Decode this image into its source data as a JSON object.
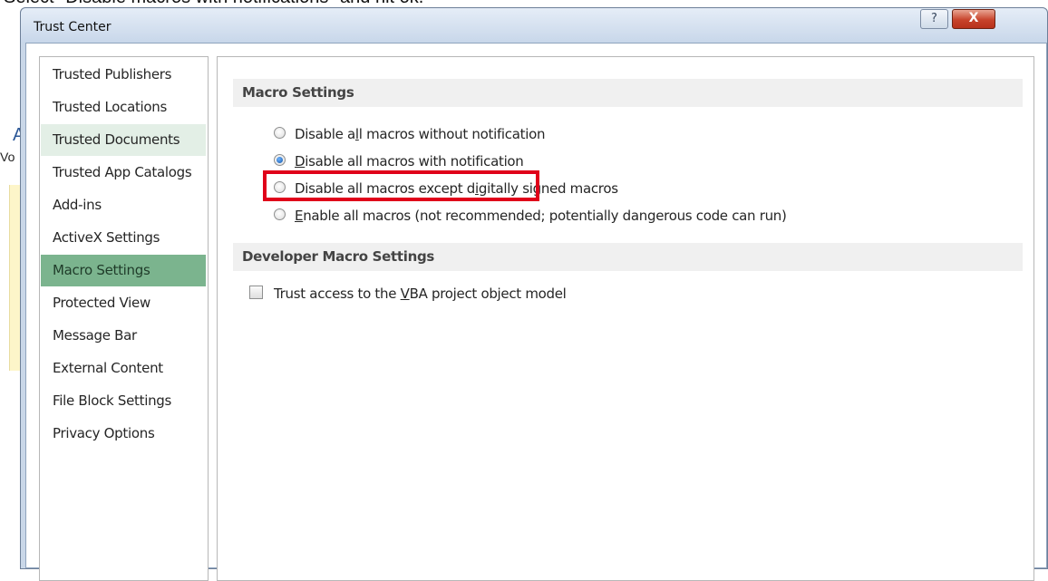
{
  "background": {
    "caption": "Select \"Disable macros with notifications\" and hit ok.",
    "letter_a": "A",
    "letter_vo": "Vo"
  },
  "dialog": {
    "title": "Trust Center",
    "help_glyph": "?",
    "close_glyph": "X"
  },
  "sidebar": {
    "items": [
      {
        "label": "Trusted Publishers",
        "state": "normal"
      },
      {
        "label": "Trusted Locations",
        "state": "normal"
      },
      {
        "label": "Trusted Documents",
        "state": "hover"
      },
      {
        "label": "Trusted App Catalogs",
        "state": "normal"
      },
      {
        "label": "Add-ins",
        "state": "normal"
      },
      {
        "label": "ActiveX Settings",
        "state": "normal"
      },
      {
        "label": "Macro Settings",
        "state": "selected"
      },
      {
        "label": "Protected View",
        "state": "normal"
      },
      {
        "label": "Message Bar",
        "state": "normal"
      },
      {
        "label": "External Content",
        "state": "normal"
      },
      {
        "label": "File Block Settings",
        "state": "normal"
      },
      {
        "label": "Privacy Options",
        "state": "normal"
      }
    ]
  },
  "macro_settings": {
    "header": "Macro Settings",
    "options": [
      {
        "pre": "Disable a",
        "acc": "l",
        "post": "l macros without notification",
        "checked": false
      },
      {
        "pre": "",
        "acc": "D",
        "post": "isable all macros with notification",
        "checked": true
      },
      {
        "pre": "Disable all macros except d",
        "acc": "i",
        "post": "gitally signed macros",
        "checked": false
      },
      {
        "pre": "",
        "acc": "E",
        "post": "nable all macros (not recommended; potentially dangerous code can run)",
        "checked": false
      }
    ]
  },
  "developer_settings": {
    "header": "Developer Macro Settings",
    "checkbox": {
      "pre": "Trust access to the ",
      "acc": "V",
      "post": "BA project object model",
      "checked": false
    }
  },
  "colors": {
    "selected_nav": "#7bb48e",
    "hover_nav": "#e3efe6",
    "highlight": "#e0001a",
    "close_button": "#c7432b"
  }
}
